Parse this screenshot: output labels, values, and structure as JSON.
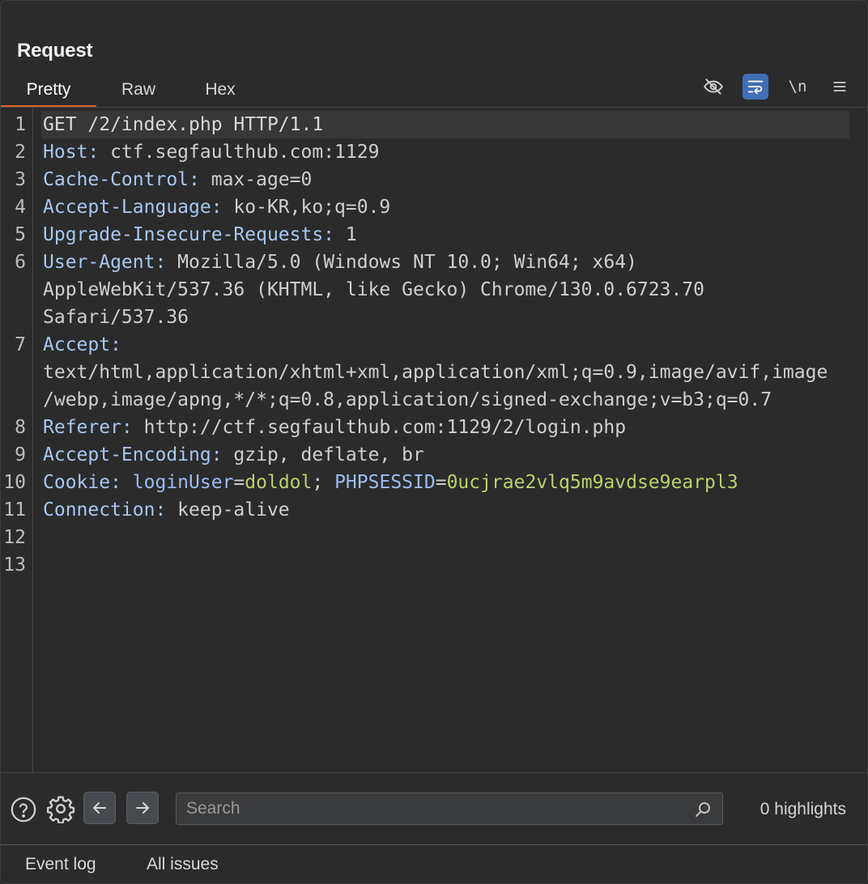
{
  "panel": {
    "title": "Request"
  },
  "tabs": [
    {
      "label": "Pretty"
    },
    {
      "label": "Raw"
    },
    {
      "label": "Hex"
    }
  ],
  "toolbar": {
    "hide_icon": "eye-slash-icon",
    "wrap_icon": "wrap-lines-icon",
    "newline_label": "\\n",
    "menu_icon": "menu-icon",
    "accent": "#3e6fb8"
  },
  "editor": {
    "line_numbers": [
      "1",
      "2",
      "3",
      "4",
      "5",
      "6",
      "7",
      "8",
      "9",
      "10",
      "11",
      "12",
      "13"
    ],
    "request_line": "GET /2/index.php HTTP/1.1",
    "headers": {
      "host": {
        "name": "Host:",
        "value": " ctf.segfaulthub.com:1129"
      },
      "cache_control": {
        "name": "Cache-Control:",
        "value": " max-age=0"
      },
      "accept_language": {
        "name": "Accept-Language:",
        "value": " ko-KR,ko;q=0.9"
      },
      "upgrade": {
        "name": "Upgrade-Insecure-Requests:",
        "value": " 1"
      },
      "user_agent": {
        "name": "User-Agent:",
        "value_line1": " Mozilla/5.0 (Windows NT 10.0; Win64; x64)",
        "value_line2": "AppleWebKit/537.36 (KHTML, like Gecko) Chrome/130.0.6723.70",
        "value_line3": "Safari/537.36"
      },
      "accept": {
        "name": "Accept:",
        "value_line1": "text/html,application/xhtml+xml,application/xml;q=0.9,image/avif,image",
        "value_line2": "/webp,image/apng,*/*;q=0.8,application/signed-exchange;v=b3;q=0.7"
      },
      "referer": {
        "name": "Referer:",
        "value": " http://ctf.segfaulthub.com:1129/2/login.php"
      },
      "accept_encoding": {
        "name": "Accept-Encoding:",
        "value": " gzip, deflate, br"
      },
      "cookie": {
        "name": "Cookie:",
        "p1_name": "loginUser",
        "eq1": "=",
        "p1_value": "doldol",
        "sep": "; ",
        "p2_name": "PHPSESSID",
        "eq2": "=",
        "p2_value": "0ucjrae2vlq5m9avdse9earpl3"
      },
      "connection": {
        "name": "Connection:",
        "value": " keep-alive"
      }
    }
  },
  "search": {
    "placeholder": "Search",
    "value": "",
    "highlights": "0 highlights"
  },
  "footer": {
    "tabs": [
      {
        "label": "Event log"
      },
      {
        "label": "All issues"
      }
    ]
  },
  "colors": {
    "background": "#2b2b2b",
    "active_tab_underline": "#e8612c",
    "header_name": "#a9c7ee",
    "cookie_value": "#b9d16a"
  }
}
